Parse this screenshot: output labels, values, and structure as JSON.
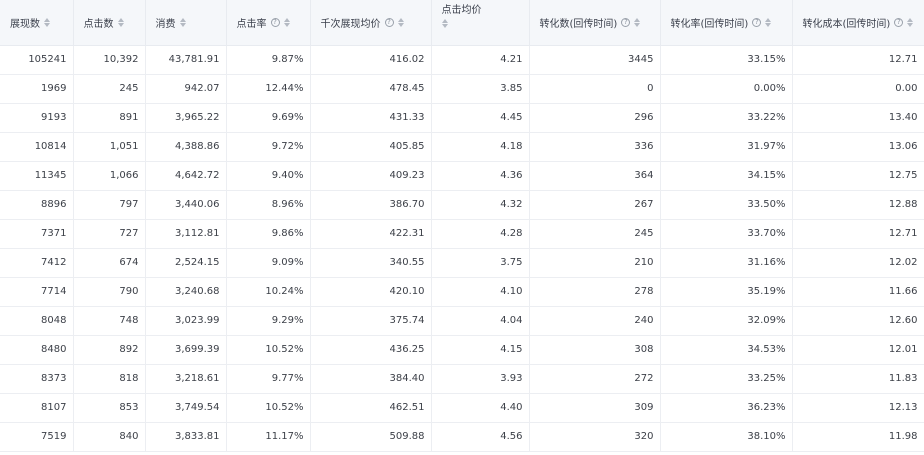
{
  "table": {
    "columns": [
      {
        "key": "impressions",
        "label": "展现数",
        "help": false,
        "wrap": false
      },
      {
        "key": "clicks",
        "label": "点击数",
        "help": false,
        "wrap": false
      },
      {
        "key": "cost",
        "label": "消费",
        "help": false,
        "wrap": false
      },
      {
        "key": "ctr",
        "label": "点击率",
        "help": true,
        "wrap": false
      },
      {
        "key": "cpm",
        "label": "千次展现均价",
        "help": true,
        "wrap": false
      },
      {
        "key": "cpc",
        "label": "点击均价",
        "help": false,
        "wrap": true
      },
      {
        "key": "conversions",
        "label": "转化数(回传时间)",
        "help": true,
        "wrap": false
      },
      {
        "key": "cvr",
        "label": "转化率(回传时间)",
        "help": true,
        "wrap": false
      },
      {
        "key": "cpa",
        "label": "转化成本(回传时间)",
        "help": true,
        "wrap": false
      }
    ],
    "help_glyph": "?",
    "rows": [
      [
        "105241",
        "10,392",
        "43,781.91",
        "9.87%",
        "416.02",
        "4.21",
        "3445",
        "33.15%",
        "12.71"
      ],
      [
        "1969",
        "245",
        "942.07",
        "12.44%",
        "478.45",
        "3.85",
        "0",
        "0.00%",
        "0.00"
      ],
      [
        "9193",
        "891",
        "3,965.22",
        "9.69%",
        "431.33",
        "4.45",
        "296",
        "33.22%",
        "13.40"
      ],
      [
        "10814",
        "1,051",
        "4,388.86",
        "9.72%",
        "405.85",
        "4.18",
        "336",
        "31.97%",
        "13.06"
      ],
      [
        "11345",
        "1,066",
        "4,642.72",
        "9.40%",
        "409.23",
        "4.36",
        "364",
        "34.15%",
        "12.75"
      ],
      [
        "8896",
        "797",
        "3,440.06",
        "8.96%",
        "386.70",
        "4.32",
        "267",
        "33.50%",
        "12.88"
      ],
      [
        "7371",
        "727",
        "3,112.81",
        "9.86%",
        "422.31",
        "4.28",
        "245",
        "33.70%",
        "12.71"
      ],
      [
        "7412",
        "674",
        "2,524.15",
        "9.09%",
        "340.55",
        "3.75",
        "210",
        "31.16%",
        "12.02"
      ],
      [
        "7714",
        "790",
        "3,240.68",
        "10.24%",
        "420.10",
        "4.10",
        "278",
        "35.19%",
        "11.66"
      ],
      [
        "8048",
        "748",
        "3,023.99",
        "9.29%",
        "375.74",
        "4.04",
        "240",
        "32.09%",
        "12.60"
      ],
      [
        "8480",
        "892",
        "3,699.39",
        "10.52%",
        "436.25",
        "4.15",
        "308",
        "34.53%",
        "12.01"
      ],
      [
        "8373",
        "818",
        "3,218.61",
        "9.77%",
        "384.40",
        "3.93",
        "272",
        "33.25%",
        "11.83"
      ],
      [
        "8107",
        "853",
        "3,749.54",
        "10.52%",
        "462.51",
        "4.40",
        "309",
        "36.23%",
        "12.13"
      ],
      [
        "7519",
        "840",
        "3,833.81",
        "11.17%",
        "509.88",
        "4.56",
        "320",
        "38.10%",
        "11.98"
      ]
    ]
  }
}
